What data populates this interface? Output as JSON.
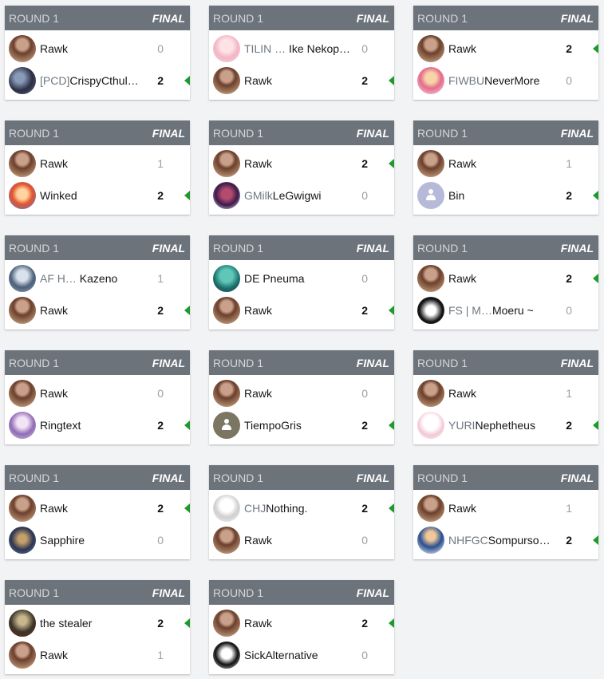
{
  "colors": {
    "header_bg": "#6d737b",
    "win_arrow": "#1d9a2b",
    "page_bg": "#f2f3f5"
  },
  "matches": [
    {
      "round": "ROUND 1",
      "status": "FINAL",
      "players": [
        {
          "tag": "",
          "name": "Rawk",
          "score": "0",
          "winner": false,
          "avatar": "av-rawk"
        },
        {
          "tag": "[PCD]",
          "name": "CrispyCthul…",
          "score": "2",
          "winner": true,
          "avatar": "av-cthul"
        }
      ]
    },
    {
      "round": "ROUND 1",
      "status": "FINAL",
      "players": [
        {
          "tag": "TILIN … ",
          "name": "Ike Nekop…",
          "score": "0",
          "winner": false,
          "avatar": "av-tilin"
        },
        {
          "tag": "",
          "name": "Rawk",
          "score": "2",
          "winner": true,
          "avatar": "av-rawk"
        }
      ]
    },
    {
      "round": "ROUND 1",
      "status": "FINAL",
      "players": [
        {
          "tag": "",
          "name": "Rawk",
          "score": "2",
          "winner": true,
          "avatar": "av-rawk"
        },
        {
          "tag": "FIWBU",
          "name": "NeverMore",
          "score": "0",
          "winner": false,
          "avatar": "av-fiwbu"
        }
      ]
    },
    {
      "round": "ROUND 1",
      "status": "FINAL",
      "players": [
        {
          "tag": "",
          "name": "Rawk",
          "score": "1",
          "winner": false,
          "avatar": "av-rawk"
        },
        {
          "tag": "",
          "name": "Winked",
          "score": "2",
          "winner": true,
          "avatar": "av-winked"
        }
      ]
    },
    {
      "round": "ROUND 1",
      "status": "FINAL",
      "players": [
        {
          "tag": "",
          "name": "Rawk",
          "score": "2",
          "winner": true,
          "avatar": "av-rawk"
        },
        {
          "tag": "GMilk",
          "name": "LeGwigwi",
          "score": "0",
          "winner": false,
          "avatar": "av-gmilk"
        }
      ]
    },
    {
      "round": "ROUND 1",
      "status": "FINAL",
      "players": [
        {
          "tag": "",
          "name": "Rawk",
          "score": "1",
          "winner": false,
          "avatar": "av-rawk"
        },
        {
          "tag": "",
          "name": "Bin",
          "score": "2",
          "winner": true,
          "avatar": "av-bin",
          "icon": "person-icon"
        }
      ]
    },
    {
      "round": "ROUND 1",
      "status": "FINAL",
      "players": [
        {
          "tag": "AF H… ",
          "name": "Kazeno",
          "score": "1",
          "winner": false,
          "avatar": "av-kazeno"
        },
        {
          "tag": "",
          "name": "Rawk",
          "score": "2",
          "winner": true,
          "avatar": "av-rawk"
        }
      ]
    },
    {
      "round": "ROUND 1",
      "status": "FINAL",
      "players": [
        {
          "tag": "",
          "name": "DE Pneuma",
          "score": "0",
          "winner": false,
          "avatar": "av-pneuma"
        },
        {
          "tag": "",
          "name": "Rawk",
          "score": "2",
          "winner": true,
          "avatar": "av-rawk"
        }
      ]
    },
    {
      "round": "ROUND 1",
      "status": "FINAL",
      "players": [
        {
          "tag": "",
          "name": "Rawk",
          "score": "2",
          "winner": true,
          "avatar": "av-rawk"
        },
        {
          "tag": "FS | M…",
          "name": "Moeru ~",
          "score": "0",
          "winner": false,
          "avatar": "av-moeru"
        }
      ]
    },
    {
      "round": "ROUND 1",
      "status": "FINAL",
      "players": [
        {
          "tag": "",
          "name": "Rawk",
          "score": "0",
          "winner": false,
          "avatar": "av-rawk"
        },
        {
          "tag": "",
          "name": "Ringtext",
          "score": "2",
          "winner": true,
          "avatar": "av-ring"
        }
      ]
    },
    {
      "round": "ROUND 1",
      "status": "FINAL",
      "players": [
        {
          "tag": "",
          "name": "Rawk",
          "score": "0",
          "winner": false,
          "avatar": "av-rawk"
        },
        {
          "tag": "",
          "name": "TiempoGris",
          "score": "2",
          "winner": true,
          "avatar": "av-tiempo",
          "icon": "person-icon"
        }
      ]
    },
    {
      "round": "ROUND 1",
      "status": "FINAL",
      "players": [
        {
          "tag": "",
          "name": "Rawk",
          "score": "1",
          "winner": false,
          "avatar": "av-rawk"
        },
        {
          "tag": "YURI",
          "name": "Nephetheus",
          "score": "2",
          "winner": true,
          "avatar": "av-yuri"
        }
      ]
    },
    {
      "round": "ROUND 1",
      "status": "FINAL",
      "players": [
        {
          "tag": "",
          "name": "Rawk",
          "score": "2",
          "winner": true,
          "avatar": "av-rawk"
        },
        {
          "tag": "",
          "name": "Sapphire",
          "score": "0",
          "winner": false,
          "avatar": "av-sapphire"
        }
      ]
    },
    {
      "round": "ROUND 1",
      "status": "FINAL",
      "players": [
        {
          "tag": "CHJ",
          "name": "Nothing.",
          "score": "2",
          "winner": true,
          "avatar": "av-chj"
        },
        {
          "tag": "",
          "name": "Rawk",
          "score": "0",
          "winner": false,
          "avatar": "av-rawk"
        }
      ]
    },
    {
      "round": "ROUND 1",
      "status": "FINAL",
      "players": [
        {
          "tag": "",
          "name": "Rawk",
          "score": "1",
          "winner": false,
          "avatar": "av-rawk"
        },
        {
          "tag": "NHFGC",
          "name": "Sompurso…",
          "score": "2",
          "winner": true,
          "avatar": "av-nhfgc"
        }
      ]
    },
    {
      "round": "ROUND 1",
      "status": "FINAL",
      "players": [
        {
          "tag": "",
          "name": "the stealer",
          "score": "2",
          "winner": true,
          "avatar": "av-stealer"
        },
        {
          "tag": "",
          "name": "Rawk",
          "score": "1",
          "winner": false,
          "avatar": "av-rawk"
        }
      ]
    },
    {
      "round": "ROUND 1",
      "status": "FINAL",
      "players": [
        {
          "tag": "",
          "name": "Rawk",
          "score": "2",
          "winner": true,
          "avatar": "av-rawk"
        },
        {
          "tag": "",
          "name": "SickAlternative",
          "score": "0",
          "winner": false,
          "avatar": "av-sick"
        }
      ]
    }
  ]
}
